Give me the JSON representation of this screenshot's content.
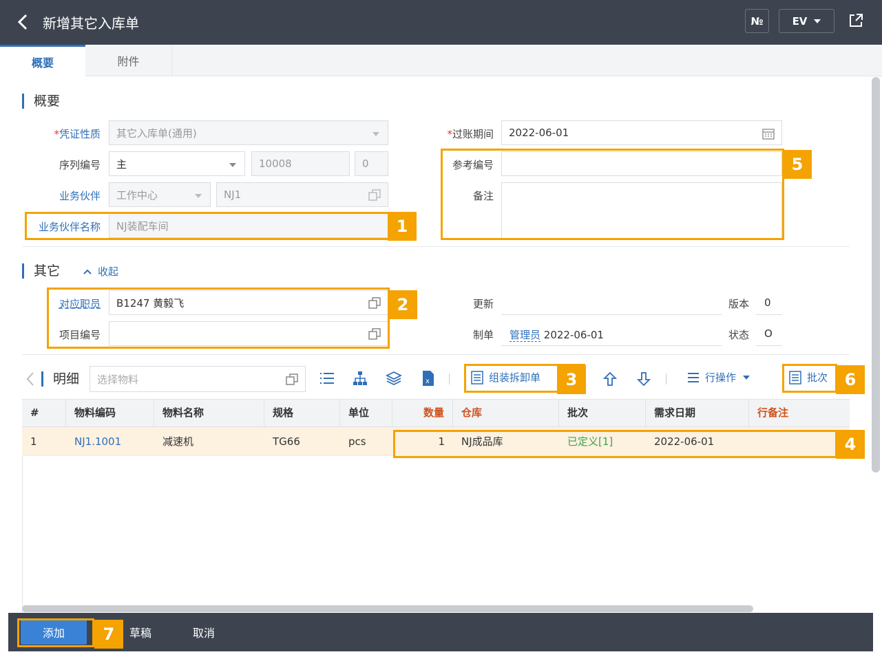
{
  "header": {
    "title": "新增其它入库单",
    "btn_no": "№",
    "btn_ev": "EV"
  },
  "tabs": [
    {
      "label": "概要",
      "active": true
    },
    {
      "label": "附件",
      "active": false
    }
  ],
  "summary": {
    "section_title": "概要",
    "voucher_type": {
      "label": "凭证性质",
      "required": "*",
      "value": "其它入库单(通用)"
    },
    "serial_no": {
      "label": "序列编号",
      "value": "主",
      "number": "10008",
      "suffix": "0"
    },
    "partner": {
      "label": "业务伙伴",
      "type": "工作中心",
      "code": "NJ1"
    },
    "partner_name": {
      "label": "业务伙伴名称",
      "value": "NJ装配车间"
    },
    "posting_period": {
      "label": "过账期间",
      "required": "*",
      "value": "2022-06-01"
    },
    "ref_no": {
      "label": "参考编号",
      "value": ""
    },
    "remark": {
      "label": "备注",
      "value": ""
    }
  },
  "other": {
    "section_title": "其它",
    "collapse_label": "收起",
    "employee": {
      "label": "对应职员",
      "value": "B1247 黄毅飞"
    },
    "project_no": {
      "label": "项目编号",
      "value": ""
    },
    "updated": {
      "label": "更新",
      "value": ""
    },
    "version": {
      "label": "版本",
      "value": "0"
    },
    "creator": {
      "label": "制单",
      "user": "管理员",
      "date": "2022-06-01"
    },
    "status": {
      "label": "状态",
      "value": "O"
    }
  },
  "detail": {
    "title": "明细",
    "material_placeholder": "选择物料",
    "assemble_label": "组装拆卸单",
    "row_ops_label": "行操作",
    "batch_label": "批次",
    "columns": [
      "#",
      "物料编码",
      "物料名称",
      "规格",
      "单位",
      "数量",
      "仓库",
      "批次",
      "需求日期",
      "行备注"
    ],
    "rows": [
      {
        "no": "1",
        "code": "NJ1.1001",
        "name": "减速机",
        "spec": "TG66",
        "unit": "pcs",
        "qty": "1",
        "warehouse": "NJ成品库",
        "batch": "已定义[1]",
        "date": "2022-06-01",
        "remark": ""
      }
    ]
  },
  "footer": {
    "add_label": "添加",
    "draft_label": "草稿",
    "cancel_label": "取消"
  },
  "annotations": [
    "1",
    "2",
    "3",
    "4",
    "5",
    "6",
    "7"
  ],
  "colors": {
    "accent": "#2f6fb8",
    "highlight": "#f4a300",
    "header_bg": "#3d4450",
    "row_bg": "#fdf1e0"
  }
}
